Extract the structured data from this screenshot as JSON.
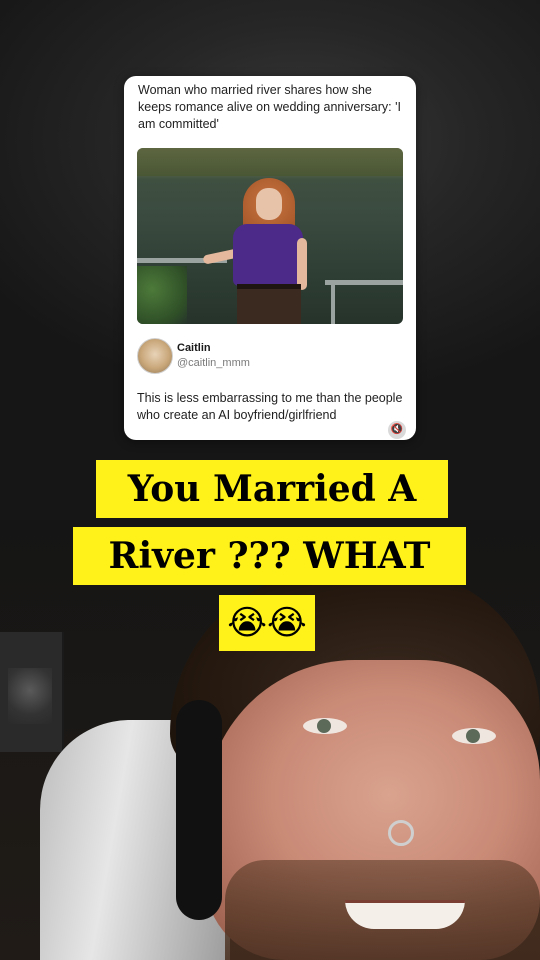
{
  "card": {
    "headline": "Woman who married river shares how she keeps romance alive on wedding anniversary: 'I am committed'",
    "author_name": "Caitlin",
    "author_handle": "@caitlin_mmm",
    "tweet_text": "This is less embarrassing to me than the people who create an AI boyfriend/girlfriend",
    "mute_icon": "speaker-muted-icon"
  },
  "caption": {
    "line1": "You Married A",
    "line2": "River ??? WHAT",
    "line3": "😭😭"
  },
  "colors": {
    "caption_bg": "#fff21a",
    "card_bg": "#ffffff",
    "shirt": "#4b2a8a"
  }
}
